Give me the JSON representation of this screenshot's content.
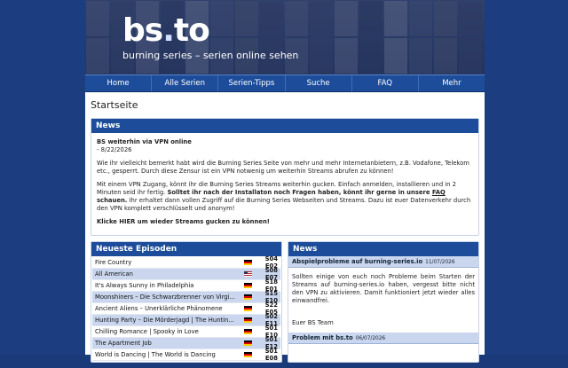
{
  "site": {
    "logo_main": "bs",
    "logo_dot": ".",
    "logo_tld": "to",
    "tagline": "burning series – serien online sehen"
  },
  "nav": [
    "Home",
    "Alle Serien",
    "Serien-Tipps",
    "Suche",
    "FAQ",
    "Mehr"
  ],
  "page_title": "Startseite",
  "news": {
    "header": "News",
    "headline": "BS weiterhin via VPN online",
    "date": "- 8/22/2026",
    "para1": "Wie ihr vielleicht bemerkt habt wird die Burning Series Seite von mehr und mehr Internetanbietern, z.B. Vodafone, Telekom etc., gesperrt. Durch diese Zensur ist ein VPN notwenig um weiterhin Streams abrufen zu können!",
    "para2_a": "Mit einem VPN Zugang, könnt ihr die Burning Series Streams weiterhin gucken. Einfach anmelden, installieren und in 2 Minuten seid ihr fertig. ",
    "para2_b": "Solltet ihr nach der Installaton noch Fragen haben, könnt ihr gerne in unsere ",
    "para2_faq": "FAQ",
    "para2_c": " schauen.",
    "para2_d": " Ihr erhaltet dann vollen Zugriff auf die Burning Series Webseiten und Streams. Dazu ist euer Datenverkehr durch den VPN komplett verschlüsselt und anonym!",
    "cta": "Klicke HIER um wieder Streams gucken zu können!"
  },
  "episodes": {
    "header": "Neueste Episoden",
    "items": [
      {
        "title": "Fire Country",
        "flag": "de",
        "code": "S04 E02"
      },
      {
        "title": "All American",
        "flag": "us",
        "code": "S08 E07"
      },
      {
        "title": "It's Always Sunny in Philadelphia",
        "flag": "de",
        "code": "S18 E01"
      },
      {
        "title": "Moonshiners – Die Schwarzbrenner von Virgi...",
        "flag": "de",
        "code": "S15 E10"
      },
      {
        "title": "Ancient Aliens – Unerklärliche Phänomene",
        "flag": "de",
        "code": "S22 E05"
      },
      {
        "title": "Hunting Party – Die Mörderjagd | The Huntin...",
        "flag": "de",
        "code": "S02 E11"
      },
      {
        "title": "Chilling Romance | Spooky in Love",
        "flag": "de",
        "code": "S01 E10"
      },
      {
        "title": "The Apartment Job",
        "flag": "de",
        "code": "S01 E12"
      },
      {
        "title": "World is Dancing | The World is Dancing",
        "flag": "de",
        "code": "S01 E08"
      }
    ]
  },
  "side_news": {
    "header": "News",
    "items": [
      {
        "title": "Abspielprobleme auf burning-series.io",
        "date": "11/07/2026",
        "body": "Sollten einige von euch noch Probleme beim Starten der Streams auf burning-series.io haben, vergesst bitte nicht den VPN zu aktivieren. Damit funktioniert jetzt wieder alles einwandfrei.",
        "signoff": "Euer BS Team"
      },
      {
        "title": "Problem mit bs.to",
        "date": "06/07/2026"
      }
    ]
  },
  "colors": {
    "accent": "#1d4d9a",
    "row_alt": "#c9d6ee",
    "background": "#1a3a7a"
  }
}
